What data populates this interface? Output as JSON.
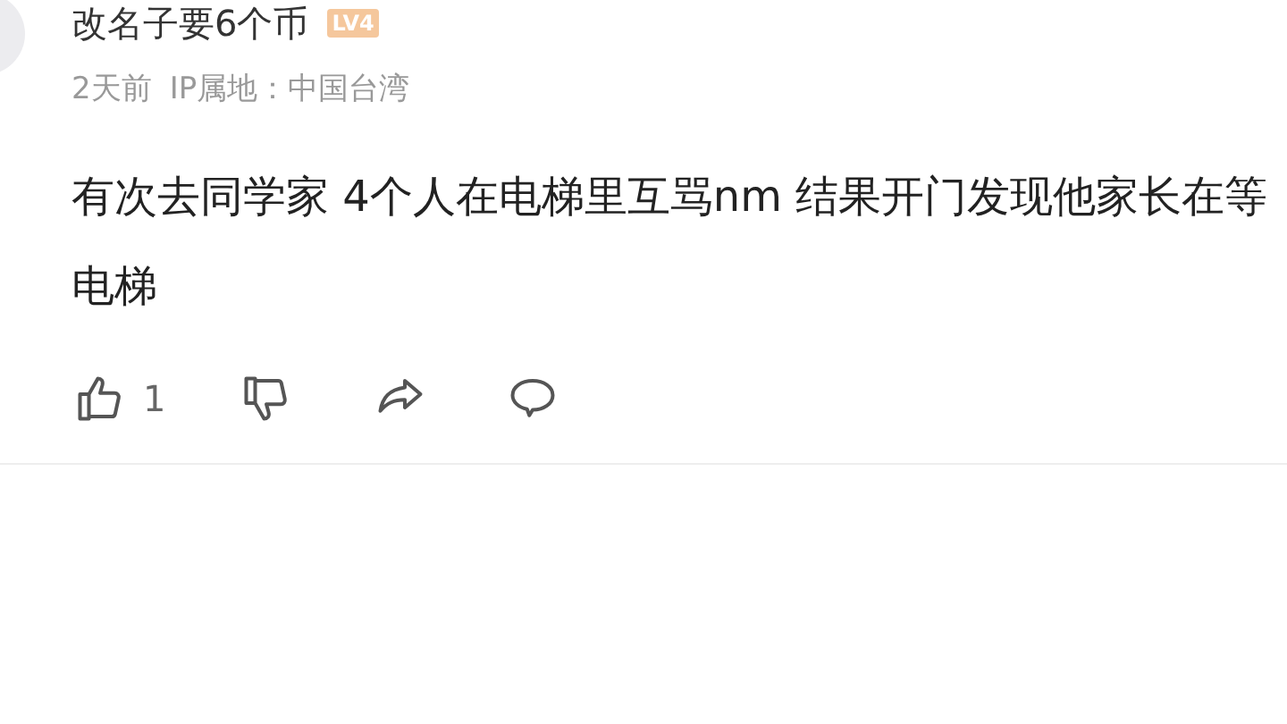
{
  "comment": {
    "username": "改名子要6个币",
    "level_badge": "LV4",
    "time": "2天前",
    "ip_location": "IP属地：中国台湾",
    "text": "有次去同学家 4个人在电梯里互骂nm 结果开门发现他家长在等电梯",
    "likes": "1"
  }
}
